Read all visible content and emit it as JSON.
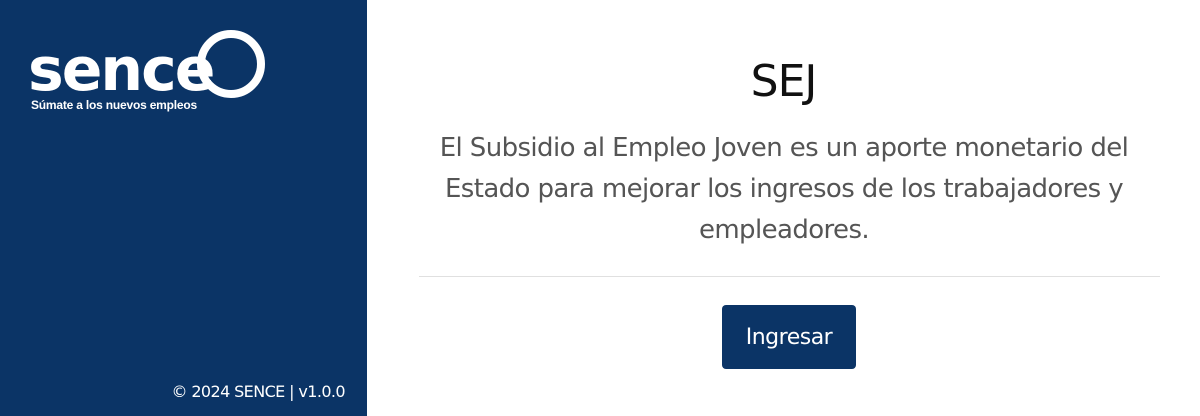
{
  "sidebar": {
    "logo": {
      "text": "sence",
      "tagline": "Súmate a los nuevos empleos"
    },
    "footer": "© 2024 SENCE | v1.0.0"
  },
  "main": {
    "title": "SEJ",
    "description": "El Subsidio al Empleo Joven es un aporte monetario del Estado para mejorar los ingresos de los trabajadores y empleadores.",
    "button_label": "Ingresar"
  },
  "colors": {
    "sidebar_bg": "#0b3466",
    "button_bg": "#0b3466",
    "text_primary": "#111111",
    "text_secondary": "#555555"
  }
}
